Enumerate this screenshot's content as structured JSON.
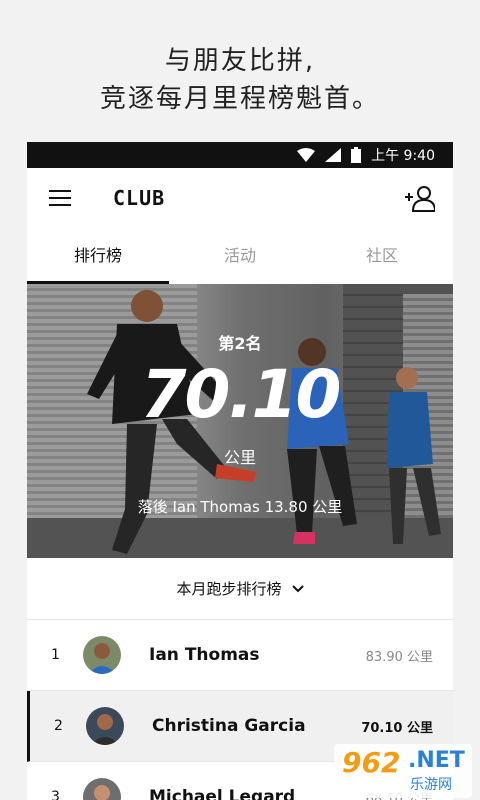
{
  "promo": {
    "line1": "与朋友比拼,",
    "line2": "竞逐每月里程榜魁首。"
  },
  "status_bar": {
    "time": "上午 9:40",
    "icons": [
      "wifi-icon",
      "signal-icon",
      "battery-icon"
    ]
  },
  "app_bar": {
    "title": "CLUB",
    "left_icon": "hamburger-menu-icon",
    "right_icon": "add-friend-icon"
  },
  "tabs": [
    {
      "label": "排行榜",
      "active": true
    },
    {
      "label": "活动",
      "active": false
    },
    {
      "label": "社区",
      "active": false
    }
  ],
  "hero": {
    "rank_label": "第2名",
    "distance": "70.10",
    "unit": "公里",
    "behind_text": "落後 Ian Thomas 13.80 公里"
  },
  "leaderboard_filter": {
    "label": "本月跑步排行榜",
    "icon": "chevron-down-icon"
  },
  "leaderboard": [
    {
      "rank": "1",
      "name": "Ian Thomas",
      "distance": "83.90 公里",
      "is_me": false
    },
    {
      "rank": "2",
      "name": "Christina Garcia",
      "distance": "70.10 公里",
      "is_me": true
    },
    {
      "rank": "3",
      "name": "Michael Legard",
      "distance": "68.10 公里",
      "is_me": false
    }
  ],
  "watermark": {
    "number": "962",
    "net": ".NET",
    "sub": "乐游网"
  },
  "colors": {
    "accent": "#111111",
    "muted": "#999999",
    "watermark_orange": "#f39c12",
    "watermark_blue": "#2a82d6"
  }
}
